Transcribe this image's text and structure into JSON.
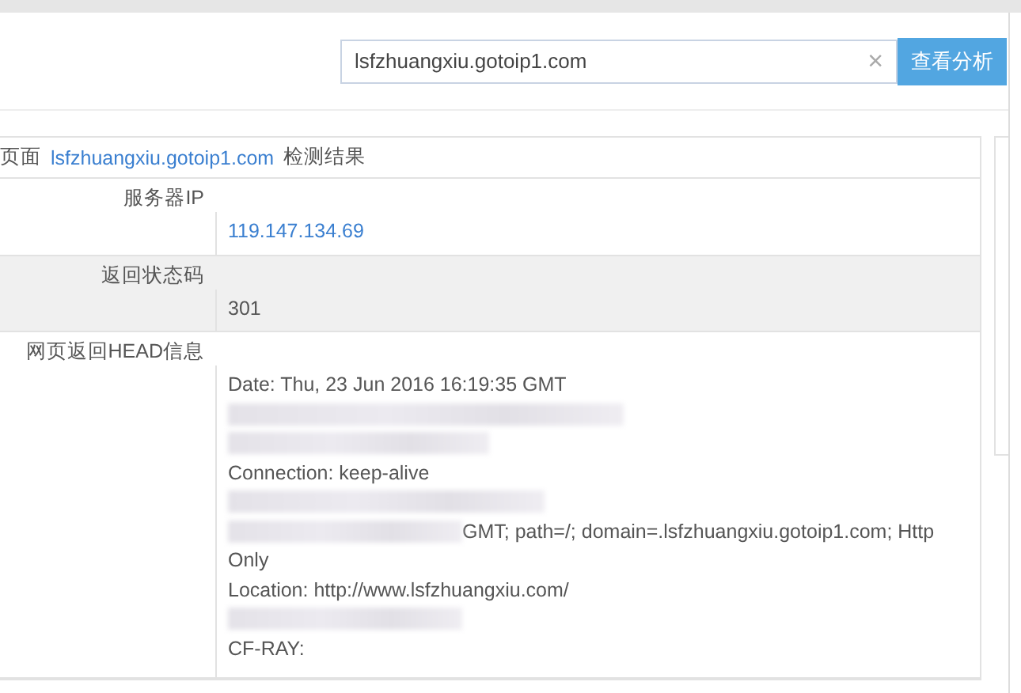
{
  "search": {
    "value": "lsfzhuangxiu.gotoip1.com",
    "clear": "×",
    "button": "查看分析"
  },
  "result_header": {
    "prefix": "页面",
    "domain": "lsfzhuangxiu.gotoip1.com",
    "suffix": "检测结果"
  },
  "rows": [
    {
      "label": "服务器IP",
      "kind": "link",
      "value": "119.147.134.69",
      "shaded": false
    },
    {
      "label": "返回状态码",
      "kind": "text",
      "value": "301",
      "shaded": true
    },
    {
      "label": "网页返回HEAD信息",
      "kind": "lines",
      "shaded": false,
      "lines": [
        {
          "kind": "text",
          "text": "Date: Thu, 23 Jun 2016 16:19:35 GMT"
        },
        {
          "kind": "redacted"
        },
        {
          "kind": "redacted"
        },
        {
          "kind": "text",
          "text": "Connection: keep-alive"
        },
        {
          "kind": "redacted"
        },
        {
          "kind": "redacted",
          "text": "GMT; path=/; domain=.lsfzhuangxiu.gotoip1.com; Http"
        },
        {
          "kind": "text",
          "text": "Only"
        },
        {
          "kind": "text",
          "text": "Location: http://www.lsfzhuangxiu.com/"
        },
        {
          "kind": "redacted"
        },
        {
          "kind": "text",
          "text": "CF-RAY:"
        }
      ]
    }
  ]
}
